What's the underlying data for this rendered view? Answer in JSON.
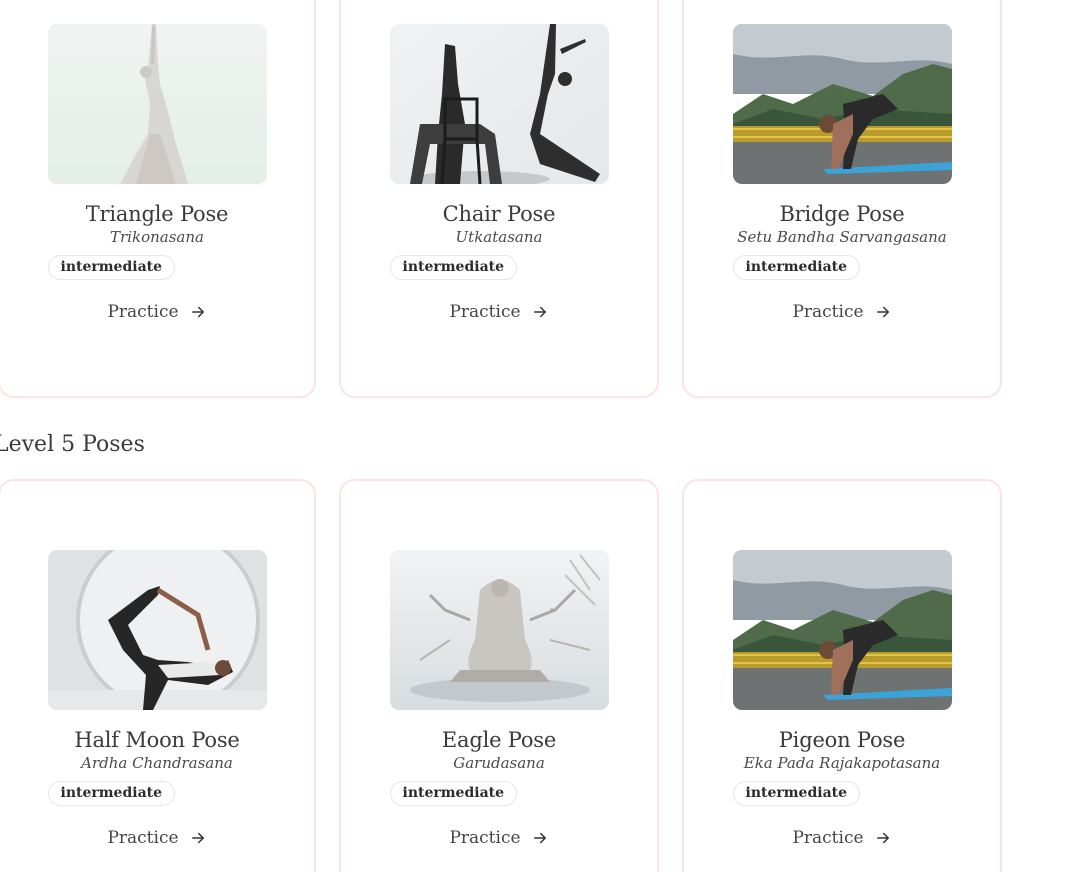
{
  "sections": [
    {
      "title": "",
      "poses": [
        {
          "name": "Triangle Pose",
          "sanskrit": "Trikonasana",
          "level": "intermediate",
          "action": "Practice",
          "image": "triangle-photo"
        },
        {
          "name": "Chair Pose",
          "sanskrit": "Utkatasana",
          "level": "intermediate",
          "action": "Practice",
          "image": "chair-photo"
        },
        {
          "name": "Bridge Pose",
          "sanskrit": "Setu Bandha Sarvangasana",
          "level": "intermediate",
          "action": "Practice",
          "image": "crow-mountain-photo"
        }
      ]
    },
    {
      "title": "Level 5 Poses",
      "poses": [
        {
          "name": "Half Moon Pose",
          "sanskrit": "Ardha Chandrasana",
          "level": "intermediate",
          "action": "Practice",
          "image": "half-moon-photo"
        },
        {
          "name": "Eagle Pose",
          "sanskrit": "Garudasana",
          "level": "intermediate",
          "action": "Practice",
          "image": "eagle-photo"
        },
        {
          "name": "Pigeon Pose",
          "sanskrit": "Eka Pada Rajakapotasana",
          "level": "intermediate",
          "action": "Practice",
          "image": "crow-mountain-photo"
        }
      ]
    }
  ],
  "colors": {
    "card_border": "#fde2e6",
    "badge_border": "#e6e6e6",
    "text": "#3a3a3a"
  },
  "icons": {
    "practice": "arrow-right-icon"
  }
}
